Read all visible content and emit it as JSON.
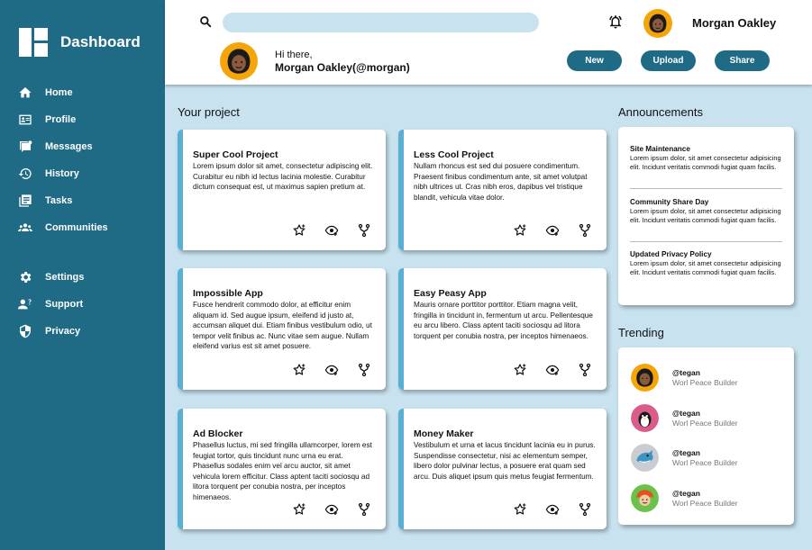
{
  "sidebar": {
    "title": "Dashboard",
    "nav_items": [
      {
        "label": "Home",
        "icon": "home-icon"
      },
      {
        "label": "Profile",
        "icon": "id-card-icon"
      },
      {
        "label": "Messages",
        "icon": "message-icon"
      },
      {
        "label": "History",
        "icon": "history-icon"
      },
      {
        "label": "Tasks",
        "icon": "tasks-icon"
      },
      {
        "label": "Communities",
        "icon": "group-icon"
      }
    ],
    "secondary_items": [
      {
        "label": "Settings",
        "icon": "gear-icon"
      },
      {
        "label": "Support",
        "icon": "support-icon"
      },
      {
        "label": "Privacy",
        "icon": "shield-icon"
      }
    ]
  },
  "header": {
    "search_placeholder": "",
    "user_name": "Morgan Oakley",
    "greeting": "Hi there,",
    "greeting_name": "Morgan Oakley(@morgan)",
    "buttons": {
      "new": "New",
      "upload": "Upload",
      "share": "Share"
    }
  },
  "projects": {
    "title": "Your project",
    "cards": [
      {
        "title": "Super Cool Project",
        "desc": "Lorem ipsum dolor sit amet, consectetur adipiscing elit. Curabitur eu nibh id lectus lacinia molestie. Curabitur dictum consequat est, ut maximus sapien pretium at."
      },
      {
        "title": "Less Cool Project",
        "desc": "Nullam rhoncus est sed dui posuere condimentum. Praesent finibus condimentum ante, sit amet volutpat nibh ultrices ut. Cras nibh eros, dapibus vel tristique blandit, vehicula vitae dolor."
      },
      {
        "title": "Impossible App",
        "desc": "Fusce hendrerit commodo dolor, at efficitur enim aliquam id. Sed augue ipsum, eleifend id justo at, accumsan aliquet dui. Etiam finibus vestibulum odio, ut tempor velit finibus ac. Nunc vitae sem augue. Nullam eleifend varius est sit amet posuere."
      },
      {
        "title": "Easy Peasy App",
        "desc": "Mauris ornare porttitor porttitor. Etiam magna velit, fringilla in tincidunt in, fermentum ut arcu. Pellentesque eu arcu libero. Class aptent taciti sociosqu ad litora torquent per conubia nostra, per inceptos himenaeos."
      },
      {
        "title": "Ad Blocker",
        "desc": "Phasellus luctus, mi sed fringilla ullamcorper, lorem est feugiat tortor, quis tincidunt nunc urna eu erat. Phasellus sodales enim vel arcu auctor, sit amet vehicula lorem efficitur. Class aptent taciti sociosqu ad litora torquent per conubia nostra, per inceptos himenaeos."
      },
      {
        "title": "Money Maker",
        "desc": "Vestibulum et urna et lacus tincidunt lacinia eu in purus. Suspendisse consectetur, nisi ac elementum semper, libero dolor pulvinar lectus, a posuere erat quam sed arcu. Duis aliquet ipsum quis metus feugiat fermentum."
      }
    ]
  },
  "announcements": {
    "title": "Announcements",
    "items": [
      {
        "title": "Site Maintenance",
        "text": "Lorem ipsum dolor, sit amet consectetur adipisicing elit. Incidunt veritatis commodi fugiat quam facilis."
      },
      {
        "title": "Community Share Day",
        "text": "Lorem ipsum dolor, sit amet consectetur adipisicing elit. Incidunt veritatis commodi fugiat quam facilis."
      },
      {
        "title": "Updated Privacy Policy",
        "text": "Lorem ipsum dolor, sit amet consectetur adipisicing elit. Incidunt veritatis commodi fugiat quam facilis."
      }
    ]
  },
  "trending": {
    "title": "Trending",
    "items": [
      {
        "handle": "@tegan",
        "subtitle": "Worl Peace Builder",
        "avatar_bg": "#f5a40a"
      },
      {
        "handle": "@tegan",
        "subtitle": "Worl Peace Builder",
        "avatar_bg": "#d95c8a"
      },
      {
        "handle": "@tegan",
        "subtitle": "Worl Peace Builder",
        "avatar_bg": "#c9ccd0"
      },
      {
        "handle": "@tegan",
        "subtitle": "Worl Peace Builder",
        "avatar_bg": "#6bc14a"
      }
    ]
  },
  "colors": {
    "sidebar": "#1f6b86",
    "background": "#c8e3ef",
    "card_accent": "#5aafd4",
    "button": "#1f6b86"
  }
}
